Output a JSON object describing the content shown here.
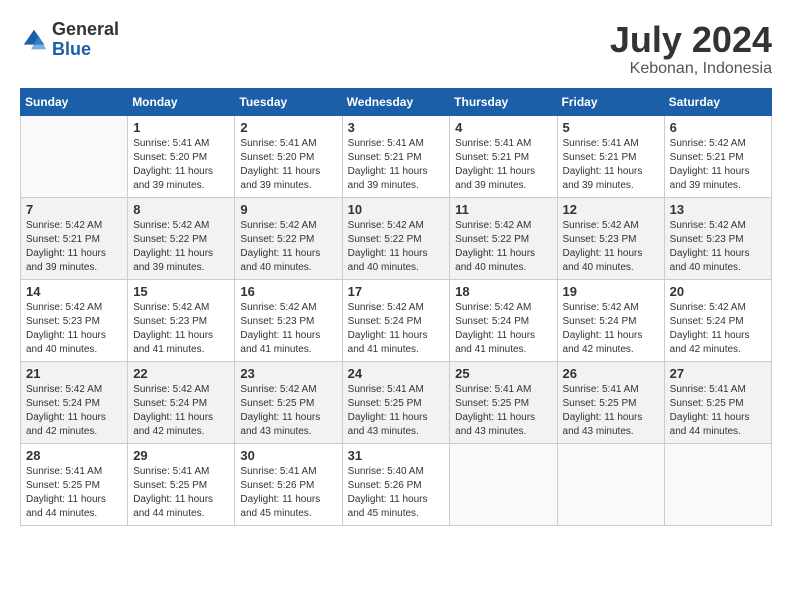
{
  "header": {
    "logo_general": "General",
    "logo_blue": "Blue",
    "month_title": "July 2024",
    "location": "Kebonan, Indonesia"
  },
  "columns": [
    "Sunday",
    "Monday",
    "Tuesday",
    "Wednesday",
    "Thursday",
    "Friday",
    "Saturday"
  ],
  "weeks": [
    [
      {
        "day": "",
        "sunrise": "",
        "sunset": "",
        "daylight": ""
      },
      {
        "day": "1",
        "sunrise": "Sunrise: 5:41 AM",
        "sunset": "Sunset: 5:20 PM",
        "daylight": "Daylight: 11 hours and 39 minutes."
      },
      {
        "day": "2",
        "sunrise": "Sunrise: 5:41 AM",
        "sunset": "Sunset: 5:20 PM",
        "daylight": "Daylight: 11 hours and 39 minutes."
      },
      {
        "day": "3",
        "sunrise": "Sunrise: 5:41 AM",
        "sunset": "Sunset: 5:21 PM",
        "daylight": "Daylight: 11 hours and 39 minutes."
      },
      {
        "day": "4",
        "sunrise": "Sunrise: 5:41 AM",
        "sunset": "Sunset: 5:21 PM",
        "daylight": "Daylight: 11 hours and 39 minutes."
      },
      {
        "day": "5",
        "sunrise": "Sunrise: 5:41 AM",
        "sunset": "Sunset: 5:21 PM",
        "daylight": "Daylight: 11 hours and 39 minutes."
      },
      {
        "day": "6",
        "sunrise": "Sunrise: 5:42 AM",
        "sunset": "Sunset: 5:21 PM",
        "daylight": "Daylight: 11 hours and 39 minutes."
      }
    ],
    [
      {
        "day": "7",
        "sunrise": "Sunrise: 5:42 AM",
        "sunset": "Sunset: 5:21 PM",
        "daylight": "Daylight: 11 hours and 39 minutes."
      },
      {
        "day": "8",
        "sunrise": "Sunrise: 5:42 AM",
        "sunset": "Sunset: 5:22 PM",
        "daylight": "Daylight: 11 hours and 39 minutes."
      },
      {
        "day": "9",
        "sunrise": "Sunrise: 5:42 AM",
        "sunset": "Sunset: 5:22 PM",
        "daylight": "Daylight: 11 hours and 40 minutes."
      },
      {
        "day": "10",
        "sunrise": "Sunrise: 5:42 AM",
        "sunset": "Sunset: 5:22 PM",
        "daylight": "Daylight: 11 hours and 40 minutes."
      },
      {
        "day": "11",
        "sunrise": "Sunrise: 5:42 AM",
        "sunset": "Sunset: 5:22 PM",
        "daylight": "Daylight: 11 hours and 40 minutes."
      },
      {
        "day": "12",
        "sunrise": "Sunrise: 5:42 AM",
        "sunset": "Sunset: 5:23 PM",
        "daylight": "Daylight: 11 hours and 40 minutes."
      },
      {
        "day": "13",
        "sunrise": "Sunrise: 5:42 AM",
        "sunset": "Sunset: 5:23 PM",
        "daylight": "Daylight: 11 hours and 40 minutes."
      }
    ],
    [
      {
        "day": "14",
        "sunrise": "Sunrise: 5:42 AM",
        "sunset": "Sunset: 5:23 PM",
        "daylight": "Daylight: 11 hours and 40 minutes."
      },
      {
        "day": "15",
        "sunrise": "Sunrise: 5:42 AM",
        "sunset": "Sunset: 5:23 PM",
        "daylight": "Daylight: 11 hours and 41 minutes."
      },
      {
        "day": "16",
        "sunrise": "Sunrise: 5:42 AM",
        "sunset": "Sunset: 5:23 PM",
        "daylight": "Daylight: 11 hours and 41 minutes."
      },
      {
        "day": "17",
        "sunrise": "Sunrise: 5:42 AM",
        "sunset": "Sunset: 5:24 PM",
        "daylight": "Daylight: 11 hours and 41 minutes."
      },
      {
        "day": "18",
        "sunrise": "Sunrise: 5:42 AM",
        "sunset": "Sunset: 5:24 PM",
        "daylight": "Daylight: 11 hours and 41 minutes."
      },
      {
        "day": "19",
        "sunrise": "Sunrise: 5:42 AM",
        "sunset": "Sunset: 5:24 PM",
        "daylight": "Daylight: 11 hours and 42 minutes."
      },
      {
        "day": "20",
        "sunrise": "Sunrise: 5:42 AM",
        "sunset": "Sunset: 5:24 PM",
        "daylight": "Daylight: 11 hours and 42 minutes."
      }
    ],
    [
      {
        "day": "21",
        "sunrise": "Sunrise: 5:42 AM",
        "sunset": "Sunset: 5:24 PM",
        "daylight": "Daylight: 11 hours and 42 minutes."
      },
      {
        "day": "22",
        "sunrise": "Sunrise: 5:42 AM",
        "sunset": "Sunset: 5:24 PM",
        "daylight": "Daylight: 11 hours and 42 minutes."
      },
      {
        "day": "23",
        "sunrise": "Sunrise: 5:42 AM",
        "sunset": "Sunset: 5:25 PM",
        "daylight": "Daylight: 11 hours and 43 minutes."
      },
      {
        "day": "24",
        "sunrise": "Sunrise: 5:41 AM",
        "sunset": "Sunset: 5:25 PM",
        "daylight": "Daylight: 11 hours and 43 minutes."
      },
      {
        "day": "25",
        "sunrise": "Sunrise: 5:41 AM",
        "sunset": "Sunset: 5:25 PM",
        "daylight": "Daylight: 11 hours and 43 minutes."
      },
      {
        "day": "26",
        "sunrise": "Sunrise: 5:41 AM",
        "sunset": "Sunset: 5:25 PM",
        "daylight": "Daylight: 11 hours and 43 minutes."
      },
      {
        "day": "27",
        "sunrise": "Sunrise: 5:41 AM",
        "sunset": "Sunset: 5:25 PM",
        "daylight": "Daylight: 11 hours and 44 minutes."
      }
    ],
    [
      {
        "day": "28",
        "sunrise": "Sunrise: 5:41 AM",
        "sunset": "Sunset: 5:25 PM",
        "daylight": "Daylight: 11 hours and 44 minutes."
      },
      {
        "day": "29",
        "sunrise": "Sunrise: 5:41 AM",
        "sunset": "Sunset: 5:25 PM",
        "daylight": "Daylight: 11 hours and 44 minutes."
      },
      {
        "day": "30",
        "sunrise": "Sunrise: 5:41 AM",
        "sunset": "Sunset: 5:26 PM",
        "daylight": "Daylight: 11 hours and 45 minutes."
      },
      {
        "day": "31",
        "sunrise": "Sunrise: 5:40 AM",
        "sunset": "Sunset: 5:26 PM",
        "daylight": "Daylight: 11 hours and 45 minutes."
      },
      {
        "day": "",
        "sunrise": "",
        "sunset": "",
        "daylight": ""
      },
      {
        "day": "",
        "sunrise": "",
        "sunset": "",
        "daylight": ""
      },
      {
        "day": "",
        "sunrise": "",
        "sunset": "",
        "daylight": ""
      }
    ]
  ]
}
